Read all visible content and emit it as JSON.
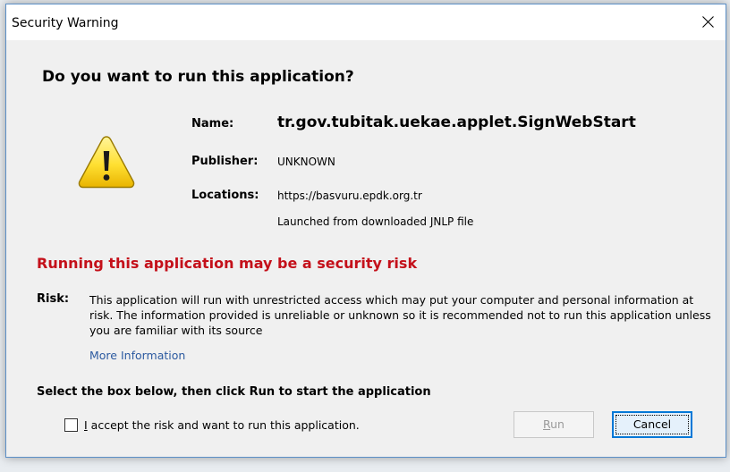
{
  "window": {
    "title": "Security Warning"
  },
  "dialog": {
    "heading": "Do you want to run this application?",
    "name_label": "Name:",
    "name_value": "tr.gov.tubitak.uekae.applet.SignWebStart",
    "publisher_label": "Publisher:",
    "publisher_value": "UNKNOWN",
    "locations_label": "Locations:",
    "location_value": "https://basvuru.epdk.org.tr",
    "launched_value": "Launched from downloaded JNLP file",
    "risk_heading": "Running this application may be a security risk",
    "risk_label": "Risk:",
    "risk_text": "This application will run with unrestricted access which may put your computer and personal information at risk. The information provided is unreliable or unknown so it is recommended not to run this application unless you are familiar with its source",
    "more_info": "More Information",
    "instruction": "Select the box below, then click Run to start the application",
    "checkbox_label_accel": "I",
    "checkbox_label_rest": " accept the risk and want to run this application.",
    "checkbox_checked": false,
    "run_accel": "R",
    "run_rest": "un",
    "cancel_label": "Cancel"
  },
  "icons": {
    "warning": "warning-triangle-icon",
    "close": "close-icon"
  },
  "colors": {
    "risk_red": "#c4101a",
    "link_blue": "#2c5aa0",
    "focus_blue": "#0078d7"
  }
}
